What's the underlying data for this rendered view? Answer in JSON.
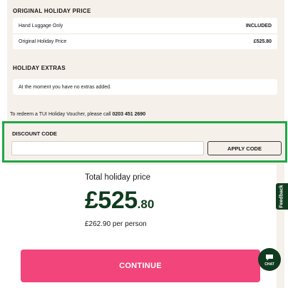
{
  "original_price": {
    "title": "ORIGINAL HOLIDAY PRICE",
    "rows": [
      {
        "label": "Hand Luggage Only",
        "value": "INCLUDED"
      },
      {
        "label": "Original Holiday Price",
        "value": "£525.80"
      }
    ]
  },
  "extras": {
    "title": "HOLIDAY EXTRAS",
    "message": "At the moment you have no extras added."
  },
  "voucher": {
    "text": "To redeem a TUI Holiday Voucher, please call ",
    "phone": "0203 451 2690"
  },
  "discount": {
    "label": "DISCOUNT CODE",
    "input_value": "",
    "input_placeholder": "",
    "apply_label": "APPLY CODE",
    "highlight_color": "#22a547"
  },
  "total": {
    "label": "Total holiday price",
    "price_main": "£525",
    "price_decimal": ".80",
    "per_person": "£262.90 per person"
  },
  "continue_label": "CONTINUE",
  "feedback_label": "Feedback",
  "chat_label": "CHAT",
  "colors": {
    "brand_dark": "#103b1f",
    "continue_pink": "#f1457c",
    "panel_beige": "#f5f0ea"
  }
}
